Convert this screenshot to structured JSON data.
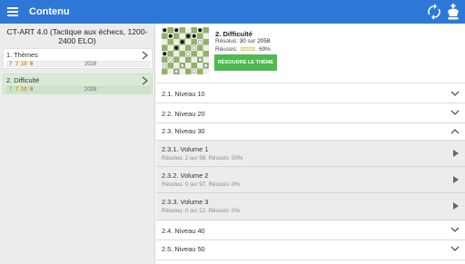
{
  "appbar": {
    "title": "Contenu",
    "icons": {
      "menu": "menu-icon",
      "sync": "sync-icon",
      "app": "chess-king-icon"
    }
  },
  "sidebar": {
    "book_title": "CT-ART 4.0 (Tactique aux échecs, 1200-2400 ELO)",
    "items": [
      {
        "label": "1. Thèmes",
        "counts": [
          "7",
          "7",
          "10",
          "6"
        ],
        "elo": "2028",
        "selected": false
      },
      {
        "label": "2. Difficulté",
        "counts": [
          "7",
          "7",
          "10",
          "6"
        ],
        "elo": "2028",
        "selected": true
      }
    ]
  },
  "theme": {
    "title": "2. Difficulté",
    "solved_prefix": "Résolus:",
    "solved_count": "30",
    "solved_mid": "sur",
    "solved_total": "2058",
    "success_label": "Réussis:",
    "success_pct": "69%",
    "button": "RÉSOUDRE LE THÈME"
  },
  "list": {
    "rows_top": [
      {
        "label": "2.1. Niveau 10",
        "state": "collapsed"
      },
      {
        "label": "2.2. Niveau 20",
        "state": "collapsed"
      },
      {
        "label": "2.3. Niveau 30",
        "state": "expanded"
      }
    ],
    "volumes": [
      {
        "title": "2.3.1. Volume 1",
        "stats": "Résolus: 2 sur 98. Réussis: 50%"
      },
      {
        "title": "2.3.2. Volume 2",
        "stats": "Résolus: 0 sur 97. Réussis: 0%"
      },
      {
        "title": "2.3.3. Volume 3",
        "stats": "Résolus: 0 sur 22. Réussis: 0%"
      }
    ],
    "rows_bottom": [
      {
        "label": "2.4. Niveau 40",
        "state": "collapsed"
      },
      {
        "label": "2.5. Niveau 50",
        "state": "collapsed"
      }
    ]
  },
  "colors": {
    "appbar": "#2d78d6",
    "button": "#4fb84f",
    "selected": "#d8ecd4"
  }
}
